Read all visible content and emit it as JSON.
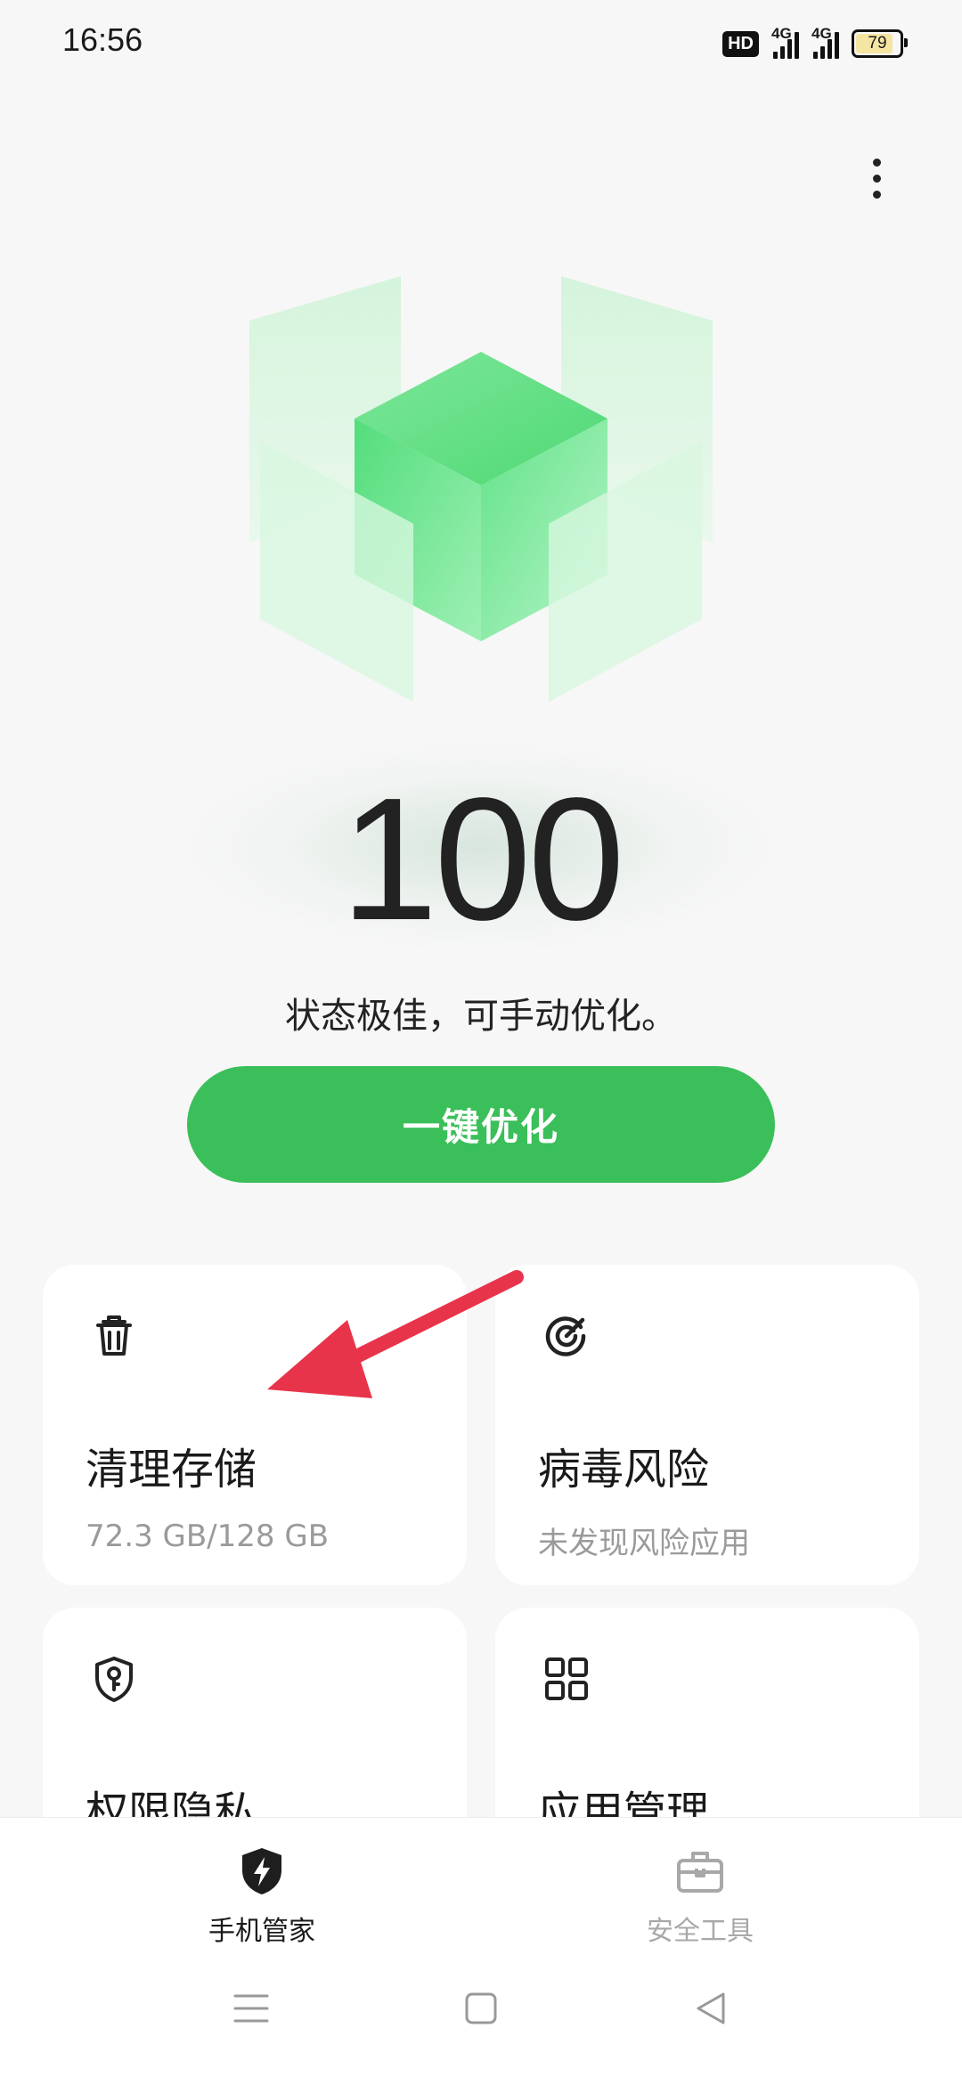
{
  "status_bar": {
    "time": "16:56",
    "hd_badge": "HD",
    "signal_1_label": "4G",
    "signal_2_label": "4G",
    "battery": "79"
  },
  "header": {
    "more_icon": "more-vertical-icon"
  },
  "score": {
    "value": "100",
    "status_text": "状态极佳，可手动优化。",
    "optimize_label": "一键优化"
  },
  "cards": [
    {
      "title": "清理存储",
      "subtitle": "72.3 GB/128 GB",
      "icon": "trash-icon"
    },
    {
      "title": "病毒风险",
      "subtitle": "未发现风险应用",
      "icon": "radar-icon"
    },
    {
      "title": "权限隐私",
      "subtitle": "",
      "icon": "shield-key-icon"
    },
    {
      "title": "应用管理",
      "subtitle": "",
      "icon": "grid-icon"
    }
  ],
  "bottom_nav": {
    "tabs": [
      {
        "label": "手机管家",
        "icon": "shield-bolt-icon",
        "active": true
      },
      {
        "label": "安全工具",
        "icon": "toolbox-icon",
        "active": false
      }
    ]
  },
  "colors": {
    "accent": "#3bbf5a",
    "annotation_arrow": "#e8344a",
    "background": "#f7f7f7"
  }
}
